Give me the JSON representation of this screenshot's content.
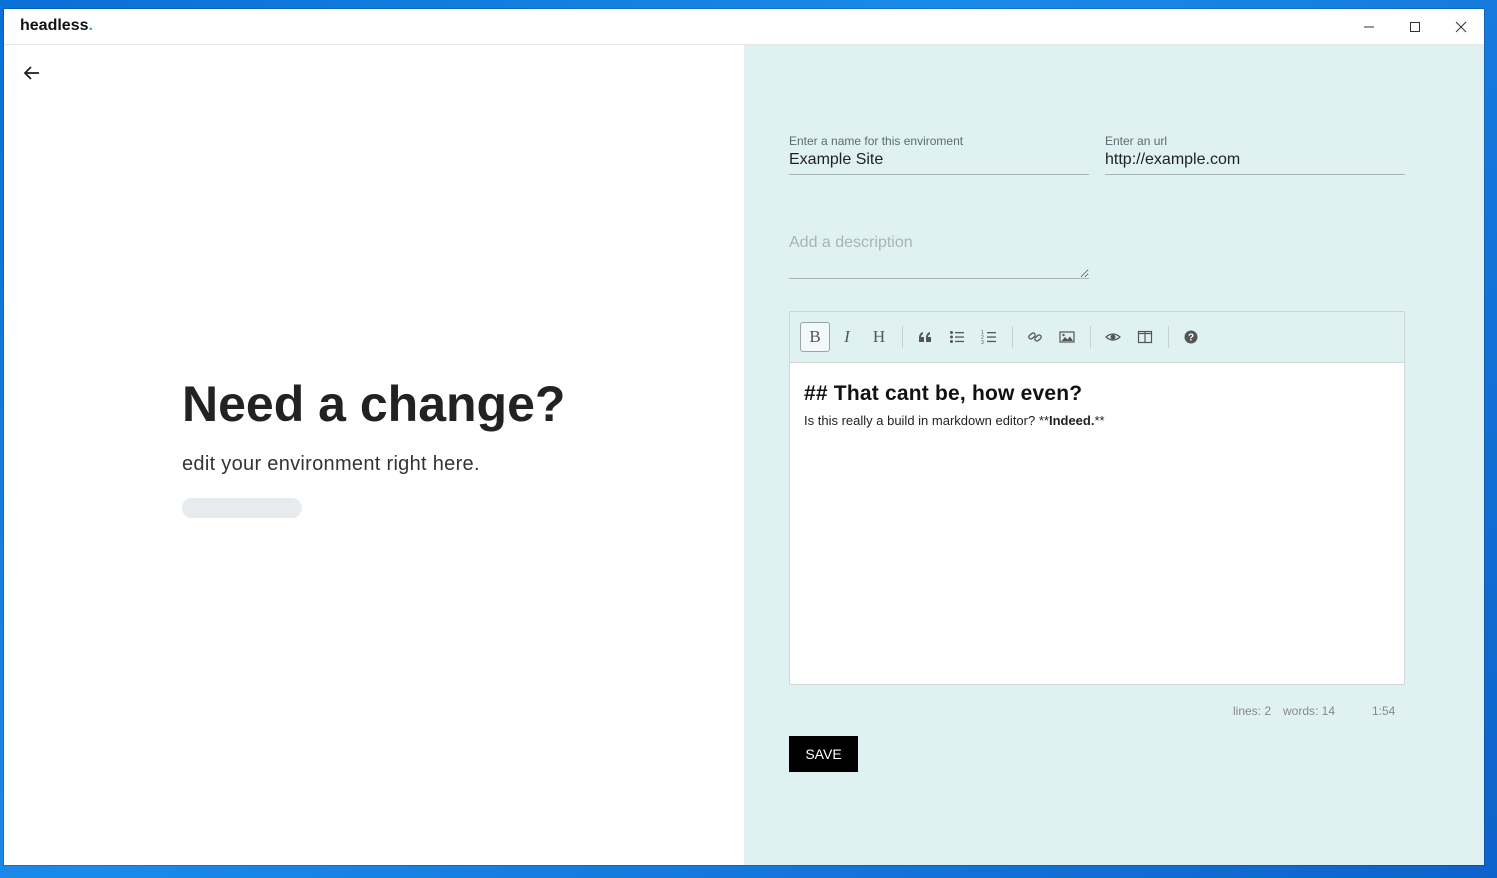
{
  "app": {
    "title": "headless",
    "title_dot": "."
  },
  "left": {
    "heading": "Need a change?",
    "subheading": "edit your environment right here."
  },
  "form": {
    "name_label": "Enter a name for this enviroment",
    "name_value": "Example Site",
    "url_label": "Enter an url",
    "url_value": "http://example.com",
    "description_placeholder": "Add a description"
  },
  "editor": {
    "toolbar": [
      {
        "name": "bold",
        "glyph": "B"
      },
      {
        "name": "italic",
        "glyph": "I"
      },
      {
        "name": "heading",
        "glyph": "H"
      },
      {
        "name": "quote"
      },
      {
        "name": "unordered-list"
      },
      {
        "name": "ordered-list"
      },
      {
        "name": "link"
      },
      {
        "name": "image"
      },
      {
        "name": "preview"
      },
      {
        "name": "side-by-side"
      },
      {
        "name": "guide"
      }
    ],
    "content_heading": "## That cant be, how even?",
    "content_text": "Is this really a build in markdown editor? **",
    "content_bold": "Indeed.",
    "content_suffix": "**",
    "status": {
      "lines": "lines: 2",
      "words": "words: 14",
      "cursor": "1:54"
    }
  },
  "save_label": "SAVE"
}
